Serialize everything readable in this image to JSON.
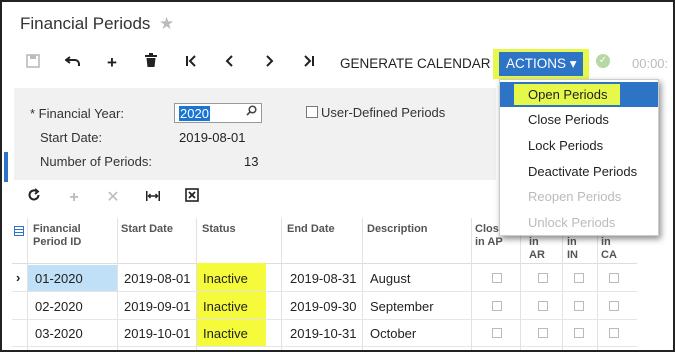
{
  "page": {
    "title": "Financial Periods"
  },
  "toolbar": {
    "generate_calendar": "GENERATE CALENDAR",
    "actions": "ACTIONS ▾",
    "time": "00:00:"
  },
  "form": {
    "financial_year_label": "* Financial Year:",
    "financial_year_value": "2020",
    "start_date_label": "Start Date:",
    "start_date_value": "2019-08-01",
    "num_periods_label": "Number of Periods:",
    "num_periods_value": "13",
    "user_defined_label": "User-Defined Periods"
  },
  "grid": {
    "headers": {
      "period_line1": "Financial",
      "period_line2": "Period ID",
      "start_date": "Start Date",
      "status": "Status",
      "end_date": "End Date",
      "description": "Description",
      "closed_ap_line1": "Clos",
      "closed_ap_line2": "in AP",
      "closed_ar_line1": "",
      "closed_ar_line2": "in",
      "closed_ar_line3": "AR",
      "closed_in_line2": "in",
      "closed_in_line3": "IN",
      "closed_ca_line2": "in",
      "closed_ca_line3": "CA"
    },
    "rows": [
      {
        "period": "01-2020",
        "start": "2019-08-01",
        "status": "Inactive",
        "end": "2019-08-31",
        "desc": "August"
      },
      {
        "period": "02-2020",
        "start": "2019-09-01",
        "status": "Inactive",
        "end": "2019-09-30",
        "desc": "September"
      },
      {
        "period": "03-2020",
        "start": "2019-10-01",
        "status": "Inactive",
        "end": "2019-10-31",
        "desc": "October"
      }
    ]
  },
  "menu": {
    "items": [
      {
        "label": "Open Periods",
        "enabled": true
      },
      {
        "label": "Close Periods",
        "enabled": true
      },
      {
        "label": "Lock Periods",
        "enabled": true
      },
      {
        "label": "Deactivate Periods",
        "enabled": true
      },
      {
        "label": "Reopen Periods",
        "enabled": false
      },
      {
        "label": "Unlock Periods",
        "enabled": false
      }
    ]
  },
  "colors": {
    "accent": "#2d74c6",
    "highlight": "#e6f94a"
  },
  "icons": [
    "star-icon",
    "save-icon",
    "undo-icon",
    "add-icon",
    "delete-icon",
    "first-icon",
    "prev-icon",
    "next-icon",
    "last-icon",
    "check-icon",
    "search-icon",
    "refresh-icon",
    "fit-columns-icon",
    "export-excel-icon",
    "row-pointer-icon"
  ]
}
